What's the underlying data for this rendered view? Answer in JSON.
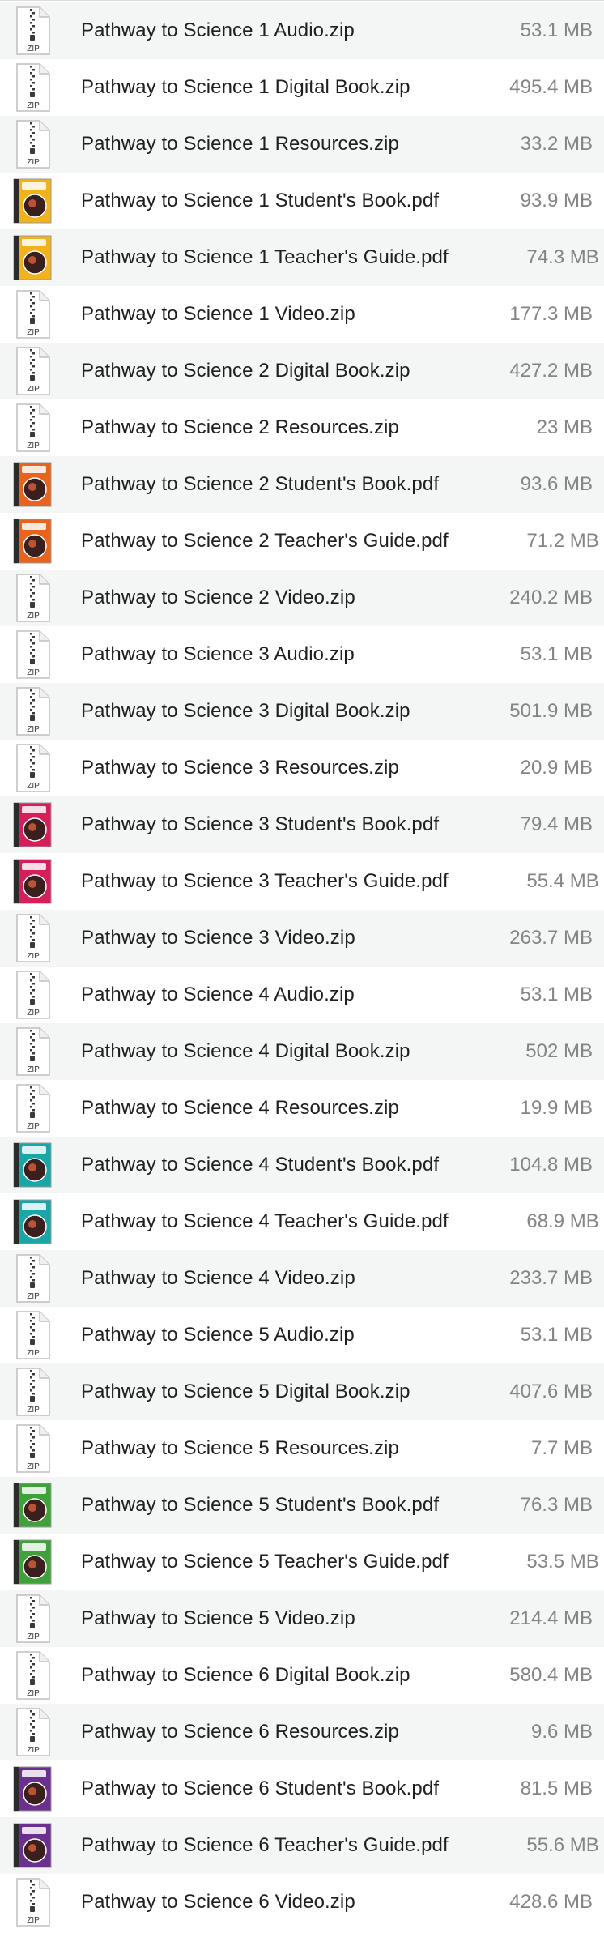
{
  "files": [
    {
      "name": "Pathway to Science 1 Audio.zip",
      "size": "53.1 MB",
      "icon": "zip-file-icon",
      "cover": null
    },
    {
      "name": "Pathway to Science 1 Digital Book.zip",
      "size": "495.4 MB",
      "icon": "zip-file-icon",
      "cover": null
    },
    {
      "name": "Pathway to Science 1 Resources.zip",
      "size": "33.2 MB",
      "icon": "zip-file-icon",
      "cover": null
    },
    {
      "name": "Pathway to Science 1 Student's Book.pdf",
      "size": "93.9 MB",
      "icon": "pdf-cover-icon",
      "cover": "#f2b21b"
    },
    {
      "name": "Pathway to Science 1 Teacher's Guide.pdf",
      "size": "74.3 MB",
      "icon": "pdf-cover-icon",
      "cover": "#f2b21b"
    },
    {
      "name": "Pathway to Science 1 Video.zip",
      "size": "177.3 MB",
      "icon": "zip-file-icon",
      "cover": null
    },
    {
      "name": "Pathway to Science 2 Digital Book.zip",
      "size": "427.2 MB",
      "icon": "zip-file-icon",
      "cover": null
    },
    {
      "name": "Pathway to Science 2 Resources.zip",
      "size": "23 MB",
      "icon": "zip-file-icon",
      "cover": null
    },
    {
      "name": "Pathway to Science 2 Student's Book.pdf",
      "size": "93.6 MB",
      "icon": "pdf-cover-icon",
      "cover": "#e8641e"
    },
    {
      "name": "Pathway to Science 2 Teacher's Guide.pdf",
      "size": "71.2 MB",
      "icon": "pdf-cover-icon",
      "cover": "#e8641e"
    },
    {
      "name": "Pathway to Science 2 Video.zip",
      "size": "240.2 MB",
      "icon": "zip-file-icon",
      "cover": null
    },
    {
      "name": "Pathway to Science 3 Audio.zip",
      "size": "53.1 MB",
      "icon": "zip-file-icon",
      "cover": null
    },
    {
      "name": "Pathway to Science 3 Digital Book.zip",
      "size": "501.9 MB",
      "icon": "zip-file-icon",
      "cover": null
    },
    {
      "name": "Pathway to Science 3 Resources.zip",
      "size": "20.9 MB",
      "icon": "zip-file-icon",
      "cover": null
    },
    {
      "name": "Pathway to Science 3 Student's Book.pdf",
      "size": "79.4 MB",
      "icon": "pdf-cover-icon",
      "cover": "#d51f5b"
    },
    {
      "name": "Pathway to Science 3 Teacher's Guide.pdf",
      "size": "55.4 MB",
      "icon": "pdf-cover-icon",
      "cover": "#d51f5b"
    },
    {
      "name": "Pathway to Science 3 Video.zip",
      "size": "263.7 MB",
      "icon": "zip-file-icon",
      "cover": null
    },
    {
      "name": "Pathway to Science 4 Audio.zip",
      "size": "53.1 MB",
      "icon": "zip-file-icon",
      "cover": null
    },
    {
      "name": "Pathway to Science 4 Digital Book.zip",
      "size": "502 MB",
      "icon": "zip-file-icon",
      "cover": null
    },
    {
      "name": "Pathway to Science 4 Resources.zip",
      "size": "19.9 MB",
      "icon": "zip-file-icon",
      "cover": null
    },
    {
      "name": "Pathway to Science 4 Student's Book.pdf",
      "size": "104.8 MB",
      "icon": "pdf-cover-icon",
      "cover": "#1aa6a6"
    },
    {
      "name": "Pathway to Science 4 Teacher's Guide.pdf",
      "size": "68.9 MB",
      "icon": "pdf-cover-icon",
      "cover": "#1aa6a6"
    },
    {
      "name": "Pathway to Science 4 Video.zip",
      "size": "233.7 MB",
      "icon": "zip-file-icon",
      "cover": null
    },
    {
      "name": "Pathway to Science 5 Audio.zip",
      "size": "53.1 MB",
      "icon": "zip-file-icon",
      "cover": null
    },
    {
      "name": "Pathway to Science 5 Digital Book.zip",
      "size": "407.6 MB",
      "icon": "zip-file-icon",
      "cover": null
    },
    {
      "name": "Pathway to Science 5 Resources.zip",
      "size": "7.7 MB",
      "icon": "zip-file-icon",
      "cover": null
    },
    {
      "name": "Pathway to Science 5 Student's Book.pdf",
      "size": "76.3 MB",
      "icon": "pdf-cover-icon",
      "cover": "#3fa13a"
    },
    {
      "name": "Pathway to Science 5 Teacher's Guide.pdf",
      "size": "53.5 MB",
      "icon": "pdf-cover-icon",
      "cover": "#3fa13a"
    },
    {
      "name": "Pathway to Science 5 Video.zip",
      "size": "214.4 MB",
      "icon": "zip-file-icon",
      "cover": null
    },
    {
      "name": "Pathway to Science 6 Digital Book.zip",
      "size": "580.4 MB",
      "icon": "zip-file-icon",
      "cover": null
    },
    {
      "name": "Pathway to Science 6 Resources.zip",
      "size": "9.6 MB",
      "icon": "zip-file-icon",
      "cover": null
    },
    {
      "name": "Pathway to Science 6 Student's Book.pdf",
      "size": "81.5 MB",
      "icon": "pdf-cover-icon",
      "cover": "#6a2f8f"
    },
    {
      "name": "Pathway to Science 6 Teacher's Guide.pdf",
      "size": "55.6 MB",
      "icon": "pdf-cover-icon",
      "cover": "#6a2f8f"
    },
    {
      "name": "Pathway to Science 6 Video.zip",
      "size": "428.6 MB",
      "icon": "zip-file-icon",
      "cover": null
    }
  ],
  "zip_badge": "ZIP"
}
